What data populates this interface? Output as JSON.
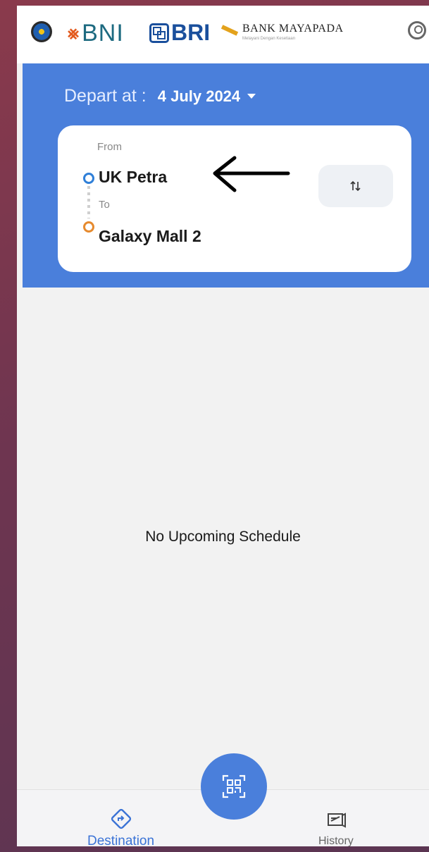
{
  "logos": {
    "bni": "BNI",
    "bri": "BRI",
    "mayapada": "BANK MAYAPADA",
    "mayapada_tagline": "Melayani Dengan Kesetiaan"
  },
  "header": {
    "depart_label": "Depart at :",
    "depart_date": "4 July 2024"
  },
  "route": {
    "from_label": "From",
    "from_value": "UK Petra",
    "to_label": "To",
    "to_value": "Galaxy Mall 2"
  },
  "schedule": {
    "empty_message": "No Upcoming Schedule"
  },
  "bottom_nav": {
    "items": [
      {
        "label": "Destination",
        "icon": "directions-icon",
        "active": true
      },
      {
        "label": "History",
        "icon": "ticket-icon",
        "active": false
      }
    ],
    "fab_icon": "qr-scan-icon"
  },
  "colors": {
    "primary": "#4a7fdb",
    "from_dot": "#2f7fd8",
    "to_dot": "#e68a2e",
    "active_nav": "#3b73d6"
  }
}
